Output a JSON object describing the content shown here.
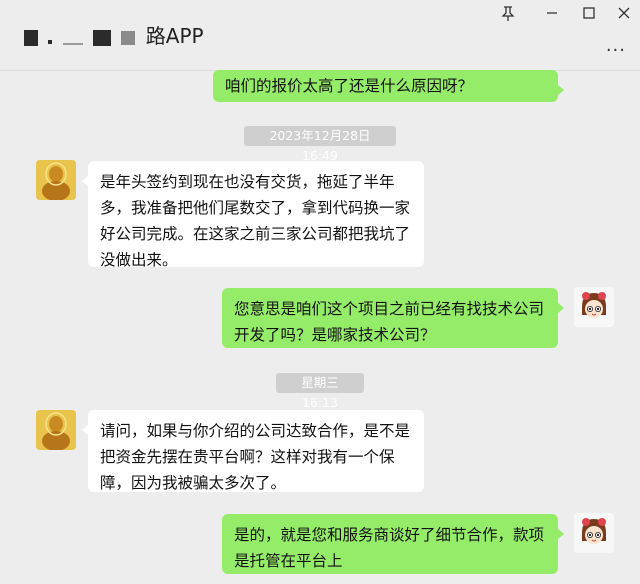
{
  "window": {
    "title": "路APP",
    "pin_icon": "pin-icon",
    "minimize_icon": "minimize-icon",
    "maximize_icon": "maximize-icon",
    "close_icon": "close-icon",
    "more_icon": "more-options-icon"
  },
  "messages": [
    {
      "id": "m1",
      "side": "me",
      "text": "咱们的报价太高了还是什么原因呀？"
    },
    {
      "id": "t1",
      "type": "timestamp",
      "text": "2023年12月28日 16:49"
    },
    {
      "id": "m2",
      "side": "other",
      "text": "是年头签约到现在也没有交货，拖延了半年多，我准备把他们尾数交了，拿到代码换一家好公司完成。在这家之前三家公司都把我坑了没做出来。"
    },
    {
      "id": "m3",
      "side": "me",
      "text": "您意思是咱们这个项目之前已经有找技术公司开发了吗？是哪家技术公司？"
    },
    {
      "id": "t2",
      "type": "timestamp",
      "text": "星期三 16:13"
    },
    {
      "id": "m4",
      "side": "other",
      "text": "请问，如果与你介绍的公司达致合作，是不是把资金先摆在贵平台啊？这样对我有一个保障，因为我被骗太多次了。"
    },
    {
      "id": "m5",
      "side": "me",
      "text": "是的，就是您和服务商谈好了细节合作，款项是托管在平台上"
    }
  ],
  "colors": {
    "me_bubble": "#95ec69",
    "other_bubble": "#ffffff",
    "background": "#ededed",
    "timestamp_bg": "#cfcfcf"
  }
}
